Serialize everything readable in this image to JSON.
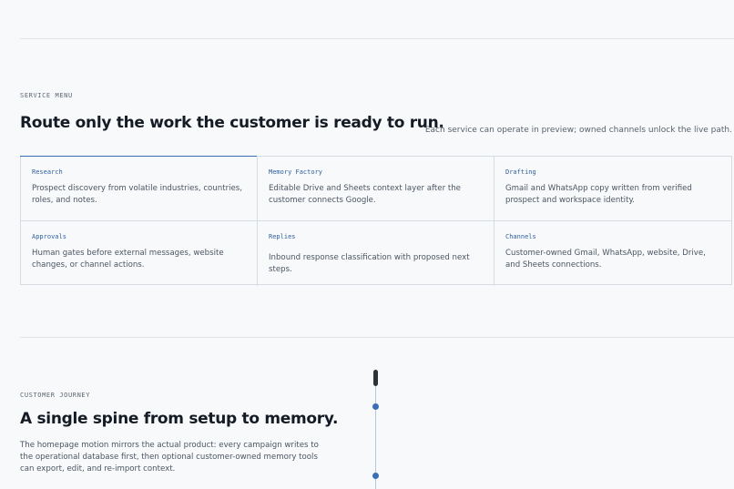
{
  "service_menu": {
    "eyebrow": "SERVICE MENU",
    "heading": "Route only the work the customer is ready to run.",
    "aside": "Each service can operate in preview; owned channels unlock the live path.",
    "services": [
      {
        "title": "Research",
        "description": "Prospect discovery from volatile industries, countries, roles, and notes."
      },
      {
        "title": "Memory Factory",
        "description": "Editable Drive and Sheets context layer after the customer connects Google."
      },
      {
        "title": "Drafting",
        "description": "Gmail and WhatsApp copy written from verified prospect and workspace identity."
      },
      {
        "title": "Approvals",
        "description": "Human gates before external messages, website changes, or channel actions."
      },
      {
        "title": "Replies",
        "description": "Inbound response classification with proposed next steps."
      },
      {
        "title": "Channels",
        "description": "Customer-owned Gmail, WhatsApp, website, Drive, and Sheets connections."
      }
    ]
  },
  "customer_journey": {
    "eyebrow": "CUSTOMER JOURNEY",
    "heading": "A single spine from setup to memory.",
    "lede": "The homepage motion mirrors the actual product: every campaign writes to the operational database first, then optional customer-owned memory tools can export, edit, and re-import context."
  },
  "colors": {
    "accent": "#3a6fb5",
    "background": "#f7f9fb",
    "border": "#d7dce2",
    "heading": "#151b24"
  }
}
